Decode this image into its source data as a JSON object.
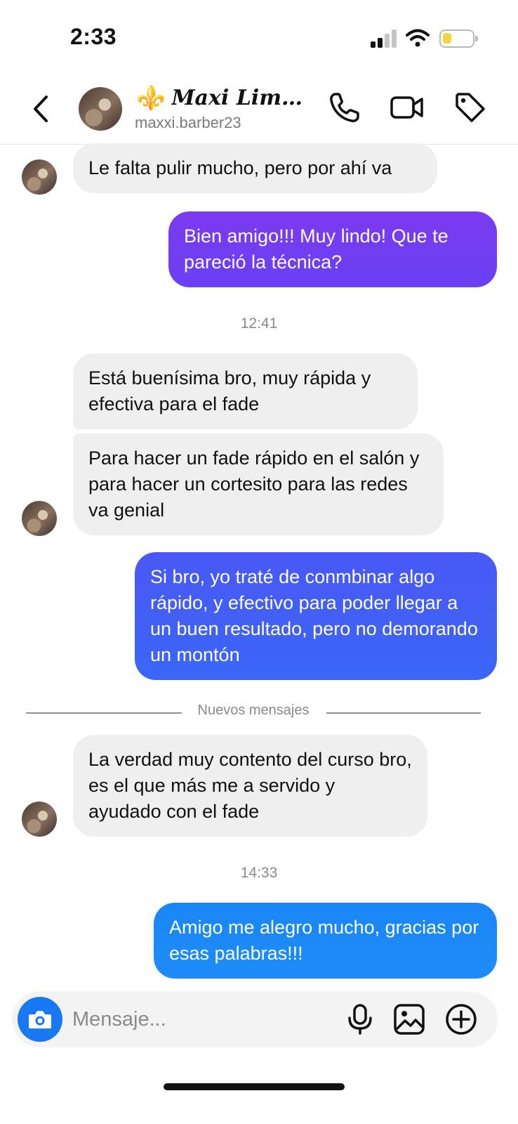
{
  "status_bar": {
    "time": "2:33",
    "battery_color": "#f6d53c",
    "icons": [
      "signal-icon",
      "wifi-icon",
      "battery-icon"
    ]
  },
  "header": {
    "emoji": "⚜️",
    "name": "𝑴𝒂𝒙𝒊 𝑳𝒊𝒎…",
    "username": "maxxi.barber23",
    "icons": [
      "back-chevron-icon",
      "phone-icon",
      "video-camera-icon",
      "tag-icon"
    ]
  },
  "messages": [
    {
      "side": "incoming",
      "text": "Le falta pulir mucho, pero por ahí va"
    },
    {
      "side": "outgoing",
      "text": "Bien amigo!!! Muy lindo! Que te pareció la técnica?"
    },
    {
      "type": "timestamp",
      "text": "12:41"
    },
    {
      "side": "incoming",
      "text": "Está buenísima bro, muy rápida y efectiva para el fade"
    },
    {
      "side": "incoming",
      "text": "Para hacer un fade rápido en el salón y para hacer un cortesito para las redes va genial"
    },
    {
      "side": "outgoing",
      "text": "Si bro, yo traté de conmbinar algo rápido, y efectivo para poder llegar a un buen resultado, pero no demorando un montón"
    },
    {
      "type": "divider",
      "text": "Nuevos mensajes"
    },
    {
      "side": "incoming",
      "text": "La verdad muy contento del curso bro, es el que más me a servido y ayudado con el fade"
    },
    {
      "type": "timestamp",
      "text": "14:33"
    },
    {
      "side": "outgoing",
      "text": "Amigo me alegro mucho, gracias por esas palabras!!!"
    }
  ],
  "composer": {
    "placeholder": "Mensaje...",
    "icons": [
      "camera-icon",
      "microphone-icon",
      "gallery-icon",
      "add-icon"
    ]
  },
  "colors": {
    "outgoing_gradient_top": "#7c3af0",
    "outgoing_gradient_mid": "#4a5cf5",
    "outgoing_gradient_bottom": "#1e8cf8",
    "incoming_bubble": "#efefef",
    "camera_button": "#1877f2"
  }
}
